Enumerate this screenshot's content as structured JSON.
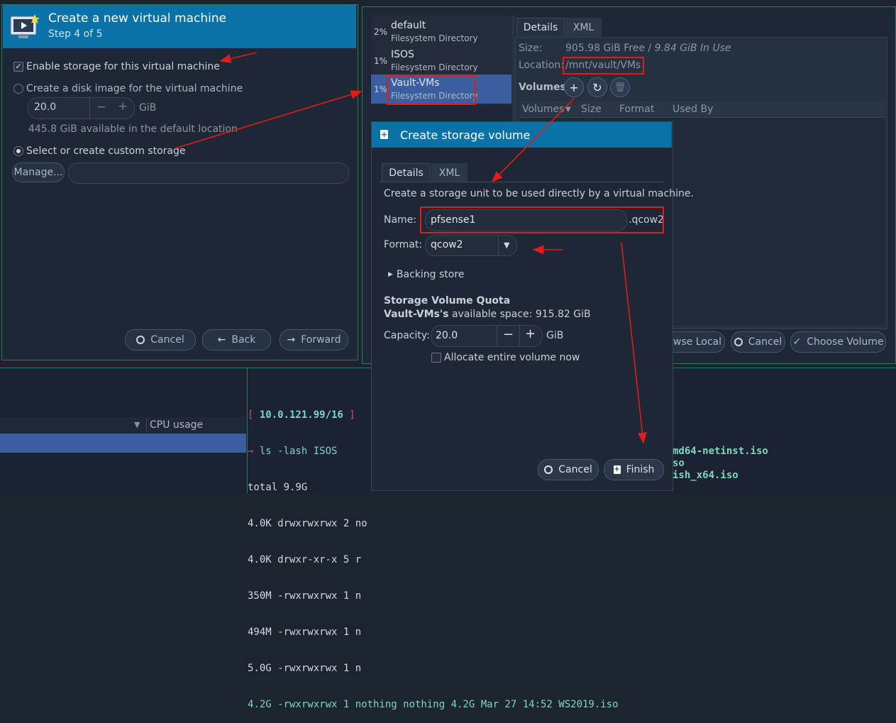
{
  "wizard": {
    "title": "Create a new virtual machine",
    "step": "Step 4 of 5",
    "enable_storage": "Enable storage for this virtual machine",
    "create_disk": "Create a disk image for the virtual machine",
    "disk_size": "20.0",
    "disk_unit": "GiB",
    "available": "445.8 GiB available in the default location",
    "custom_storage": "Select or create custom storage",
    "manage_label": "Manage...",
    "cancel_label": "Cancel",
    "back_label": "Back",
    "forward_label": "Forward"
  },
  "pools": [
    {
      "pct": "2%",
      "name": "default",
      "type": "Filesystem Directory"
    },
    {
      "pct": "1%",
      "name": "ISOS",
      "type": "Filesystem Directory"
    },
    {
      "pct": "1%",
      "name": "Vault-VMs",
      "type": "Filesystem Directory"
    }
  ],
  "details": {
    "tab_details": "Details",
    "tab_xml": "XML",
    "size_label": "Size:",
    "size_free": "905.98 GiB Free",
    "size_sep": " / ",
    "size_inuse": "9.84 GiB In Use",
    "location_label": "Location:",
    "location_value": "/mnt/vault/VMs",
    "volumes_label": "Volumes",
    "columns": [
      "Volumes",
      "Size",
      "Format",
      "Used By"
    ],
    "browse_local": "owse Local",
    "cancel_label": "Cancel",
    "choose_volume": "Choose Volume"
  },
  "dialog": {
    "title": "Create storage volume",
    "tab_details": "Details",
    "tab_xml": "XML",
    "description": "Create a storage unit to be used directly by a virtual machine.",
    "name_label": "Name:",
    "name_value": "pfsense1",
    "name_suffix": ".qcow2",
    "format_label": "Format:",
    "format_value": "qcow2",
    "backing_store": "Backing store",
    "quota_heading": "Storage Volume Quota",
    "quota_pool": "Vault-VMs's",
    "quota_text": " available space: 915.82 GiB",
    "capacity_label": "Capacity:",
    "capacity_value": "20.0",
    "capacity_unit": "GiB",
    "allocate_label": "Allocate entire volume now",
    "cancel_label": "Cancel",
    "finish_label": "Finish"
  },
  "terminal": {
    "prompt_ip": "10.0.121.99/16",
    "command": "ls -lash ISOS",
    "lines": [
      "total 9.9G",
      "4.0K drwxrwxrwx 2 no",
      "4.0K drwxr-xr-x 5 r",
      "350M -rwxrwxrwx 1 n",
      "494M -rwxrwxrwx 1 n",
      "5.0G -rwxrwxrwx 1 n",
      "4.2G -rwxrwxrwx 1 nothing nothing 4.2G Mar 27 14:52 WS2019.iso"
    ],
    "right_fragments": [
      "md64-netinst.iso",
      "so",
      "ish_x64.iso"
    ]
  },
  "monitor": {
    "cpu_usage_label": "CPU usage"
  },
  "colors": {
    "header_blue": "#0a72a6",
    "selection": "#3b5f9e",
    "annotation_red": "#e21b1b",
    "terminal_green": "#7fd6c2"
  }
}
